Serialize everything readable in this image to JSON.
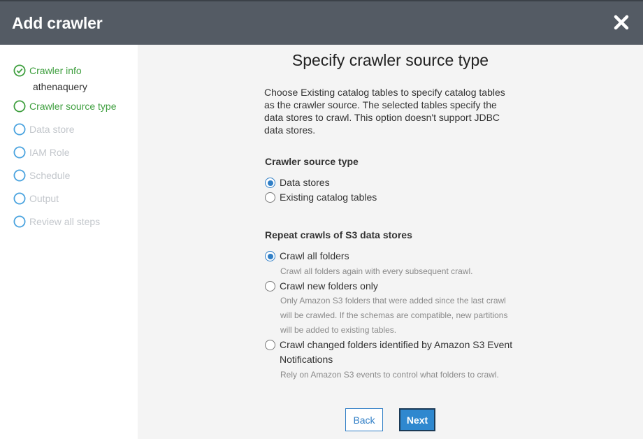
{
  "header": {
    "title": "Add crawler"
  },
  "sidebar": {
    "steps": [
      {
        "label": "Crawler info",
        "state": "done",
        "sublabel": "athenaquery"
      },
      {
        "label": "Crawler source type",
        "state": "active"
      },
      {
        "label": "Data store",
        "state": "pending"
      },
      {
        "label": "IAM Role",
        "state": "pending"
      },
      {
        "label": "Schedule",
        "state": "pending"
      },
      {
        "label": "Output",
        "state": "pending"
      },
      {
        "label": "Review all steps",
        "state": "pending"
      }
    ]
  },
  "main": {
    "title": "Specify crawler source type",
    "intro": "Choose Existing catalog tables to specify catalog tables as the crawler source. The selected tables specify the data stores to crawl. This option doesn't support JDBC data stores.",
    "source_type": {
      "label": "Crawler source type",
      "options": [
        {
          "label": "Data stores",
          "selected": true
        },
        {
          "label": "Existing catalog tables",
          "selected": false
        }
      ]
    },
    "repeat_crawls": {
      "label": "Repeat crawls of S3 data stores",
      "options": [
        {
          "label": "Crawl all folders",
          "help": "Crawl all folders again with every subsequent crawl.",
          "selected": true
        },
        {
          "label": "Crawl new folders only",
          "help": "Only Amazon S3 folders that were added since the last crawl will be crawled. If the schemas are compatible, new partitions will be added to existing tables.",
          "selected": false
        },
        {
          "label": "Crawl changed folders identified by Amazon S3 Event Notifications",
          "help": "Rely on Amazon S3 events to control what folders to crawl.",
          "selected": false
        }
      ]
    },
    "buttons": {
      "back": "Back",
      "next": "Next"
    }
  },
  "colors": {
    "header_bg": "#545b64",
    "step_done": "#3f9f3f",
    "step_pending": "#c3c7cc",
    "accent": "#2f7ec6"
  }
}
